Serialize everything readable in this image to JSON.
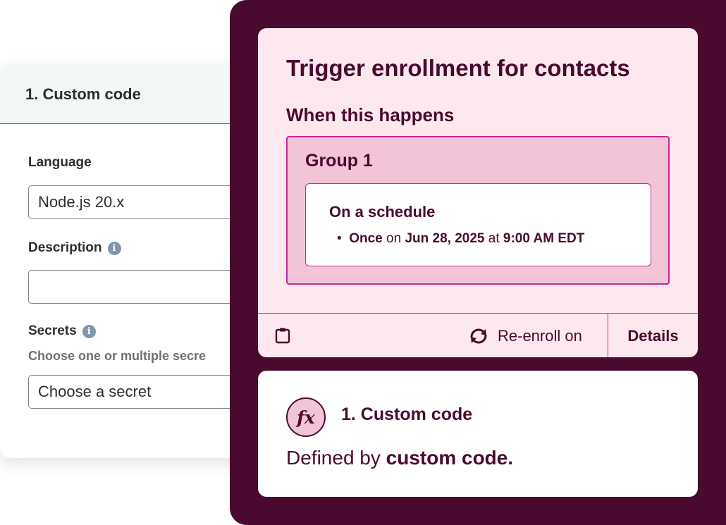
{
  "settings_panel": {
    "title": "1. Custom code",
    "language": {
      "label": "Language",
      "value": "Node.js 20.x"
    },
    "description": {
      "label": "Description",
      "value": ""
    },
    "secrets": {
      "label": "Secrets",
      "helper": "Choose one or multiple secre",
      "placeholder": "Choose a secret"
    }
  },
  "trigger": {
    "title": "Trigger enrollment for contacts",
    "when_label": "When this happens",
    "group": {
      "title": "Group 1",
      "schedule_title": "On a schedule",
      "bullet": "•",
      "frequency": "Once",
      "on_word": "on",
      "date": "Jun 28, 2025",
      "at_word": "at",
      "time": "9:00 AM EDT"
    },
    "footer": {
      "reenroll_label": "Re-enroll on",
      "details_label": "Details"
    }
  },
  "action": {
    "icon_text": "fx",
    "title": "1. Custom code",
    "desc_prefix": "Defined by",
    "desc_bold": "custom code."
  },
  "colors": {
    "dark_panel": "#4a0a2f",
    "trigger_card": "#fde8f0",
    "group_bg": "#f3c3d8",
    "accent_border": "#c6279a",
    "info_icon": "#7e95ab"
  },
  "icons": [
    "info-icon",
    "clipboard-icon",
    "reenroll-icon",
    "fx-icon"
  ]
}
